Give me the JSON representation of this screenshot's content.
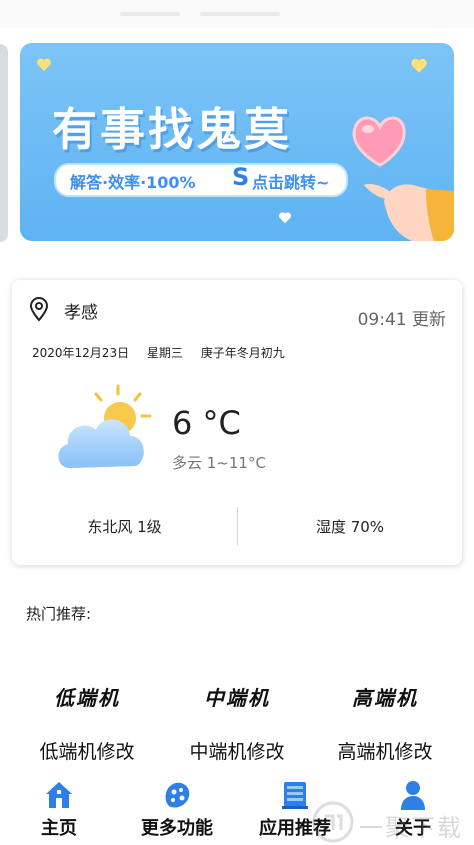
{
  "banner": {
    "title": "有事找鬼莫",
    "pill_text": "解答·效率·100%",
    "pill_icon": "S",
    "pill_text2": "点击跳转~"
  },
  "weather": {
    "city": "孝感",
    "update_time": "09:41 更新",
    "date": "2020年12月23日",
    "weekday": "星期三",
    "lunar": "庚子年冬月初九",
    "temperature": "6 °C",
    "condition": "多云 1~11°C",
    "wind": "东北风 1级",
    "humidity": "湿度 70%"
  },
  "hot": {
    "title": "热门推荐:",
    "items": [
      {
        "logo": "低端机",
        "label": "低端机修改"
      },
      {
        "logo": "中端机",
        "label": "中端机修改"
      },
      {
        "logo": "高端机",
        "label": "高端机修改"
      }
    ]
  },
  "nav": {
    "items": [
      {
        "label": "主页",
        "icon": "home-icon"
      },
      {
        "label": "更多功能",
        "icon": "more-features-icon"
      },
      {
        "label": "应用推荐",
        "icon": "app-store-icon"
      },
      {
        "label": "关于",
        "icon": "user-icon"
      }
    ]
  },
  "watermark": "一聚下载",
  "colors": {
    "banner_bg": "#6bbcf5",
    "accent_blue": "#3f8ff0",
    "nav_icon_blue": "#2f7fe8"
  }
}
